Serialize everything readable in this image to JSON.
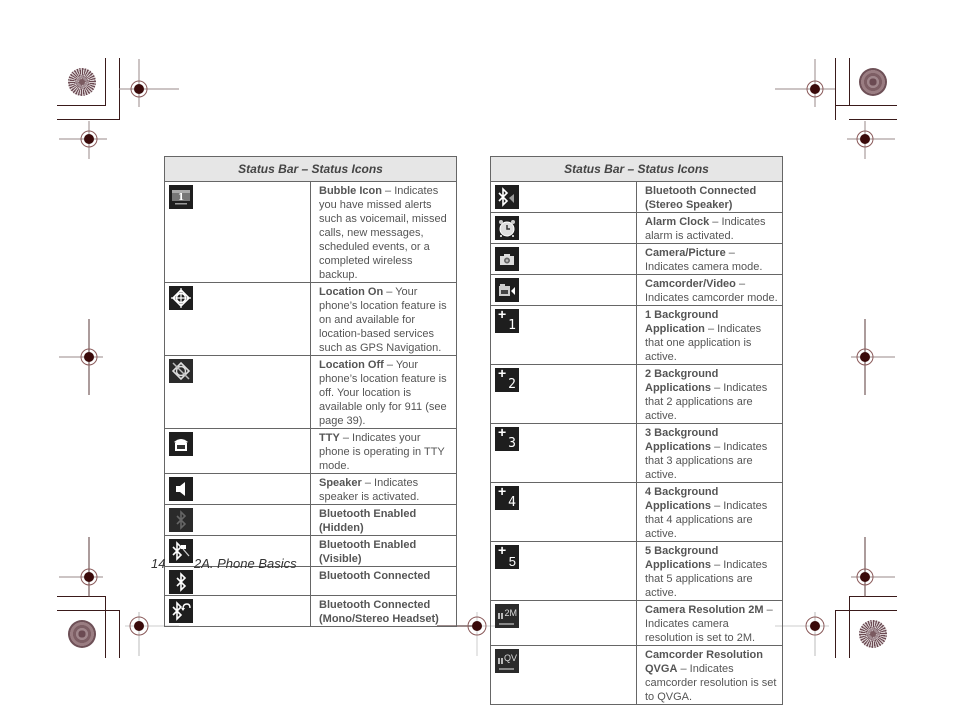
{
  "left_table": {
    "header": "Status Bar – Status Icons",
    "rows": [
      {
        "icon": "bubble-icon",
        "title": "Bubble Icon",
        "sep": " –  ",
        "desc": "Indicates you have missed alerts such as voicemail, missed calls, new messages, scheduled events, or a completed wireless backup."
      },
      {
        "icon": "location-on-icon",
        "title": "Location On",
        "sep": " – ",
        "desc": "Your phone’s location feature is on and available for location-based services such as GPS Navigation."
      },
      {
        "icon": "location-off-icon",
        "title": "Location Off",
        "sep": " – ",
        "desc": "Your phone’s location feature is off. Your location is available only for 911 (see page 39)."
      },
      {
        "icon": "tty-icon",
        "title": "TTY",
        "sep": " – ",
        "desc": "Indicates your phone is operating in TTY mode."
      },
      {
        "icon": "speaker-icon",
        "title": "Speaker",
        "sep": " – ",
        "desc": "Indicates speaker is activated."
      },
      {
        "icon": "bluetooth-hidden-icon",
        "title": "Bluetooth Enabled (Hidden)",
        "sep": "",
        "desc": ""
      },
      {
        "icon": "bluetooth-visible-icon",
        "title": "Bluetooth Enabled (Visible)",
        "sep": "",
        "desc": ""
      },
      {
        "icon": "bluetooth-connected-icon",
        "title": "Bluetooth Connected",
        "sep": "",
        "desc": ""
      },
      {
        "icon": "bluetooth-headset-icon",
        "title": "Bluetooth Connected (Mono/Stereo Headset)",
        "sep": "",
        "desc": ""
      }
    ]
  },
  "right_table": {
    "header": "Status Bar – Status Icons",
    "rows": [
      {
        "icon": "bluetooth-stereo-speaker-icon",
        "title": "Bluetooth Connected (Stereo Speaker)",
        "sep": "",
        "desc": ""
      },
      {
        "icon": "alarm-clock-icon",
        "title": "Alarm Clock",
        "sep": " – ",
        "desc": "Indicates alarm is activated."
      },
      {
        "icon": "camera-icon",
        "title": "Camera/Picture",
        "sep": " – ",
        "desc": "Indicates camera mode."
      },
      {
        "icon": "camcorder-icon",
        "title": "Camcorder/Video",
        "sep": " – ",
        "desc": "Indicates camcorder mode."
      },
      {
        "icon": "background-app-1-icon",
        "glyph": "1",
        "title": "1 Background Application",
        "sep": " – ",
        "desc": "Indicates that one application is active."
      },
      {
        "icon": "background-app-2-icon",
        "glyph": "2",
        "title": "2 Background Applications",
        "sep": " – ",
        "desc": "Indicates that 2 applications are active."
      },
      {
        "icon": "background-app-3-icon",
        "glyph": "3",
        "title": "3 Background Applications",
        "sep": " – ",
        "desc": "Indicates that 3 applications are active."
      },
      {
        "icon": "background-app-4-icon",
        "glyph": "4",
        "title": "4 Background Applications",
        "sep": " – ",
        "desc": "Indicates that 4 applications are active."
      },
      {
        "icon": "background-app-5-icon",
        "glyph": "5",
        "title": "5 Background Applications",
        "sep": " – ",
        "desc": "Indicates that 5 applications are active."
      },
      {
        "icon": "camera-resolution-2m-icon",
        "glyph": "2M",
        "title": "Camera Resolution 2M",
        "sep": " – ",
        "desc": "Indicates camera resolution is set to 2M."
      },
      {
        "icon": "camcorder-resolution-qvga-icon",
        "glyph": "QV",
        "title": "Camcorder Resolution QVGA",
        "sep": " – ",
        "desc": "Indicates camcorder resolution is set to QVGA."
      }
    ]
  },
  "footer": {
    "page_number": "14",
    "section": "2A. Phone Basics"
  }
}
